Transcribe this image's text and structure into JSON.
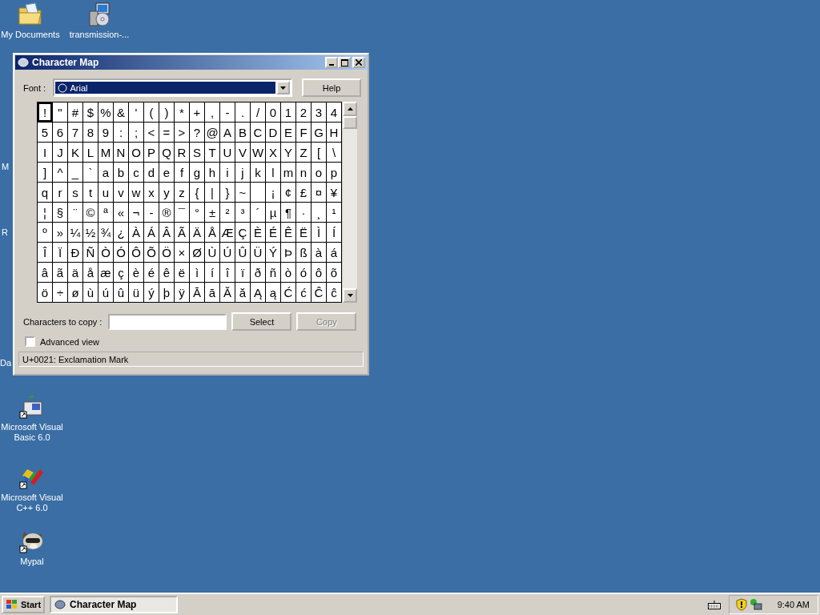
{
  "desktop_icons": [
    {
      "kind": "folder",
      "label": "My Documents"
    },
    {
      "kind": "installer",
      "label": "transmission-..."
    },
    {
      "kind": "partial",
      "label": "M"
    },
    {
      "kind": "partial",
      "label": "R"
    },
    {
      "kind": "partial",
      "label": "Da"
    },
    {
      "kind": "vb",
      "label": "Microsoft Visual Basic 6.0"
    },
    {
      "kind": "vcpp",
      "label": "Microsoft Visual C++ 6.0"
    },
    {
      "kind": "raccoon",
      "label": "Mypal"
    }
  ],
  "window": {
    "title": "Character Map",
    "font_label": "Font :",
    "font_value": "Arial",
    "help": "Help",
    "grid": [
      [
        {
          "char": "!",
          "selected": true
        },
        {
          "char": "\"",
          "selected": false
        },
        {
          "char": "#",
          "selected": false
        },
        {
          "char": "$",
          "selected": false
        },
        {
          "char": "%",
          "selected": false
        },
        {
          "char": "&",
          "selected": false
        },
        {
          "char": "'",
          "selected": false
        },
        {
          "char": "(",
          "selected": false
        },
        {
          "char": ")",
          "selected": false
        },
        {
          "char": "*",
          "selected": false
        },
        {
          "char": "+",
          "selected": false
        },
        {
          "char": ",",
          "selected": false
        },
        {
          "char": "-",
          "selected": false
        },
        {
          "char": ".",
          "selected": false
        },
        {
          "char": "/",
          "selected": false
        },
        {
          "char": "0",
          "selected": false
        },
        {
          "char": "1",
          "selected": false
        },
        {
          "char": "2",
          "selected": false
        },
        {
          "char": "3",
          "selected": false
        },
        {
          "char": "4",
          "selected": false
        }
      ],
      [
        {
          "char": "5",
          "selected": false
        },
        {
          "char": "6",
          "selected": false
        },
        {
          "char": "7",
          "selected": false
        },
        {
          "char": "8",
          "selected": false
        },
        {
          "char": "9",
          "selected": false
        },
        {
          "char": ":",
          "selected": false
        },
        {
          "char": ";",
          "selected": false
        },
        {
          "char": "<",
          "selected": false
        },
        {
          "char": "=",
          "selected": false
        },
        {
          "char": ">",
          "selected": false
        },
        {
          "char": "?",
          "selected": false
        },
        {
          "char": "@",
          "selected": false
        },
        {
          "char": "A",
          "selected": false
        },
        {
          "char": "B",
          "selected": false
        },
        {
          "char": "C",
          "selected": false
        },
        {
          "char": "D",
          "selected": false
        },
        {
          "char": "E",
          "selected": false
        },
        {
          "char": "F",
          "selected": false
        },
        {
          "char": "G",
          "selected": false
        },
        {
          "char": "H",
          "selected": false
        }
      ],
      [
        {
          "char": "I",
          "selected": false
        },
        {
          "char": "J",
          "selected": false
        },
        {
          "char": "K",
          "selected": false
        },
        {
          "char": "L",
          "selected": false
        },
        {
          "char": "M",
          "selected": false
        },
        {
          "char": "N",
          "selected": false
        },
        {
          "char": "O",
          "selected": false
        },
        {
          "char": "P",
          "selected": false
        },
        {
          "char": "Q",
          "selected": false
        },
        {
          "char": "R",
          "selected": false
        },
        {
          "char": "S",
          "selected": false
        },
        {
          "char": "T",
          "selected": false
        },
        {
          "char": "U",
          "selected": false
        },
        {
          "char": "V",
          "selected": false
        },
        {
          "char": "W",
          "selected": false
        },
        {
          "char": "X",
          "selected": false
        },
        {
          "char": "Y",
          "selected": false
        },
        {
          "char": "Z",
          "selected": false
        },
        {
          "char": "[",
          "selected": false
        },
        {
          "char": "\\",
          "selected": false
        }
      ],
      [
        {
          "char": "]",
          "selected": false
        },
        {
          "char": "^",
          "selected": false
        },
        {
          "char": "_",
          "selected": false
        },
        {
          "char": "`",
          "selected": false
        },
        {
          "char": "a",
          "selected": false
        },
        {
          "char": "b",
          "selected": false
        },
        {
          "char": "c",
          "selected": false
        },
        {
          "char": "d",
          "selected": false
        },
        {
          "char": "e",
          "selected": false
        },
        {
          "char": "f",
          "selected": false
        },
        {
          "char": "g",
          "selected": false
        },
        {
          "char": "h",
          "selected": false
        },
        {
          "char": "i",
          "selected": false
        },
        {
          "char": "j",
          "selected": false
        },
        {
          "char": "k",
          "selected": false
        },
        {
          "char": "l",
          "selected": false
        },
        {
          "char": "m",
          "selected": false
        },
        {
          "char": "n",
          "selected": false
        },
        {
          "char": "o",
          "selected": false
        },
        {
          "char": "p",
          "selected": false
        }
      ],
      [
        {
          "char": "q",
          "selected": false
        },
        {
          "char": "r",
          "selected": false
        },
        {
          "char": "s",
          "selected": false
        },
        {
          "char": "t",
          "selected": false
        },
        {
          "char": "u",
          "selected": false
        },
        {
          "char": "v",
          "selected": false
        },
        {
          "char": "w",
          "selected": false
        },
        {
          "char": "x",
          "selected": false
        },
        {
          "char": "y",
          "selected": false
        },
        {
          "char": "z",
          "selected": false
        },
        {
          "char": "{",
          "selected": false
        },
        {
          "char": "|",
          "selected": false
        },
        {
          "char": "}",
          "selected": false
        },
        {
          "char": "~",
          "selected": false
        },
        {
          "selected": false
        },
        {
          "char": "¡",
          "selected": false
        },
        {
          "char": "¢",
          "selected": false
        },
        {
          "char": "£",
          "selected": false
        },
        {
          "char": "¤",
          "selected": false
        },
        {
          "char": "¥",
          "selected": false
        }
      ],
      [
        {
          "char": "¦",
          "selected": false
        },
        {
          "char": "§",
          "selected": false
        },
        {
          "char": "¨",
          "selected": false
        },
        {
          "char": "©",
          "selected": false
        },
        {
          "char": "ª",
          "selected": false
        },
        {
          "char": "«",
          "selected": false
        },
        {
          "char": "¬",
          "selected": false
        },
        {
          "char": "-",
          "selected": false
        },
        {
          "char": "®",
          "selected": false
        },
        {
          "char": "¯",
          "selected": false
        },
        {
          "char": "°",
          "selected": false
        },
        {
          "char": "±",
          "selected": false
        },
        {
          "char": "²",
          "selected": false
        },
        {
          "char": "³",
          "selected": false
        },
        {
          "char": "´",
          "selected": false
        },
        {
          "char": "µ",
          "selected": false
        },
        {
          "char": "¶",
          "selected": false
        },
        {
          "char": "·",
          "selected": false
        },
        {
          "char": "¸",
          "selected": false
        },
        {
          "char": "¹",
          "selected": false
        }
      ],
      [
        {
          "char": "º",
          "selected": false
        },
        {
          "char": "»",
          "selected": false
        },
        {
          "char": "¼",
          "selected": false
        },
        {
          "char": "½",
          "selected": false
        },
        {
          "char": "¾",
          "selected": false
        },
        {
          "char": "¿",
          "selected": false
        },
        {
          "char": "À",
          "selected": false
        },
        {
          "char": "Á",
          "selected": false
        },
        {
          "char": "Â",
          "selected": false
        },
        {
          "char": "Ã",
          "selected": false
        },
        {
          "char": "Ä",
          "selected": false
        },
        {
          "char": "Å",
          "selected": false
        },
        {
          "char": "Æ",
          "selected": false
        },
        {
          "char": "Ç",
          "selected": false
        },
        {
          "char": "È",
          "selected": false
        },
        {
          "char": "É",
          "selected": false
        },
        {
          "char": "Ê",
          "selected": false
        },
        {
          "char": "Ë",
          "selected": false
        },
        {
          "char": "Ì",
          "selected": false
        },
        {
          "char": "Í",
          "selected": false
        }
      ],
      [
        {
          "char": "Î",
          "selected": false
        },
        {
          "char": "Ï",
          "selected": false
        },
        {
          "char": "Ð",
          "selected": false
        },
        {
          "char": "Ñ",
          "selected": false
        },
        {
          "char": "Ò",
          "selected": false
        },
        {
          "char": "Ó",
          "selected": false
        },
        {
          "char": "Ô",
          "selected": false
        },
        {
          "char": "Õ",
          "selected": false
        },
        {
          "char": "Ö",
          "selected": false
        },
        {
          "char": "×",
          "selected": false
        },
        {
          "char": "Ø",
          "selected": false
        },
        {
          "char": "Ù",
          "selected": false
        },
        {
          "char": "Ú",
          "selected": false
        },
        {
          "char": "Û",
          "selected": false
        },
        {
          "char": "Ü",
          "selected": false
        },
        {
          "char": "Ý",
          "selected": false
        },
        {
          "char": "Þ",
          "selected": false
        },
        {
          "char": "ß",
          "selected": false
        },
        {
          "char": "à",
          "selected": false
        },
        {
          "char": "á",
          "selected": false
        }
      ],
      [
        {
          "char": "â",
          "selected": false
        },
        {
          "char": "ã",
          "selected": false
        },
        {
          "char": "ä",
          "selected": false
        },
        {
          "char": "å",
          "selected": false
        },
        {
          "char": "æ",
          "selected": false
        },
        {
          "char": "ç",
          "selected": false
        },
        {
          "char": "è",
          "selected": false
        },
        {
          "char": "é",
          "selected": false
        },
        {
          "char": "ê",
          "selected": false
        },
        {
          "char": "ë",
          "selected": false
        },
        {
          "char": "ì",
          "selected": false
        },
        {
          "char": "í",
          "selected": false
        },
        {
          "char": "î",
          "selected": false
        },
        {
          "char": "ï",
          "selected": false
        },
        {
          "char": "ð",
          "selected": false
        },
        {
          "char": "ñ",
          "selected": false
        },
        {
          "char": "ò",
          "selected": false
        },
        {
          "char": "ó",
          "selected": false
        },
        {
          "char": "ô",
          "selected": false
        },
        {
          "char": "õ",
          "selected": false
        }
      ],
      [
        {
          "char": "ö",
          "selected": false
        },
        {
          "char": "÷",
          "selected": false
        },
        {
          "char": "ø",
          "selected": false
        },
        {
          "char": "ù",
          "selected": false
        },
        {
          "char": "ú",
          "selected": false
        },
        {
          "char": "û",
          "selected": false
        },
        {
          "char": "ü",
          "selected": false
        },
        {
          "char": "ý",
          "selected": false
        },
        {
          "char": "þ",
          "selected": false
        },
        {
          "char": "ÿ",
          "selected": false
        },
        {
          "char": "Ā",
          "selected": false
        },
        {
          "char": "ā",
          "selected": false
        },
        {
          "char": "Ă",
          "selected": false
        },
        {
          "char": "ă",
          "selected": false
        },
        {
          "char": "Ą",
          "selected": false
        },
        {
          "char": "ą",
          "selected": false
        },
        {
          "char": "Ć",
          "selected": false
        },
        {
          "char": "ć",
          "selected": false
        },
        {
          "char": "Ĉ",
          "selected": false
        },
        {
          "char": "ĉ",
          "selected": false
        }
      ]
    ],
    "copy_label": "Characters to copy :",
    "select": "Select",
    "copy": {
      "label": "Copy",
      "disabled": true
    },
    "advanced_view": {
      "label": "Advanced view",
      "checked": false
    },
    "status": "U+0021: Exclamation Mark"
  },
  "taskbar": {
    "start": "Start",
    "tasks": [
      {
        "label": "Character Map",
        "selected": true
      }
    ],
    "clock": "9:40 AM"
  }
}
